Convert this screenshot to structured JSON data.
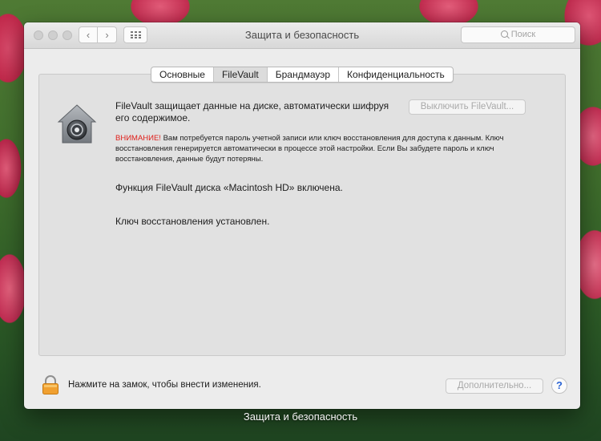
{
  "window": {
    "title": "Защита и безопасность",
    "search_placeholder": "Поиск",
    "nav_back": "‹",
    "nav_forward": "›"
  },
  "tabs": [
    {
      "label": "Основные",
      "active": false
    },
    {
      "label": "FileVault",
      "active": true
    },
    {
      "label": "Брандмауэр",
      "active": false
    },
    {
      "label": "Конфиденциальность",
      "active": false
    }
  ],
  "filevault": {
    "description": "FileVault защищает данные на диске, автоматически шифруя его содержимое.",
    "turn_off_button": "Выключить FileVault...",
    "warning_label": "ВНИМАНИЕ!",
    "warning_text": " Вам потребуется пароль учетной записи или ключ восстановления для доступа к данным. Ключ восстановления генерируется автоматически в процессе этой настройки. Если Вы забудете пароль и ключ восстановления, данные будут потеряны.",
    "status_enabled": "Функция FileVault диска «Macintosh HD» включена.",
    "status_key": "Ключ восстановления установлен."
  },
  "footer": {
    "lock_text": "Нажмите на замок, чтобы внести изменения.",
    "advanced_button": "Дополнительно...",
    "help_label": "?"
  },
  "caption": "Защита и безопасность",
  "colors": {
    "warning_red": "#e0201b",
    "lock_orange": "#f0a030",
    "help_blue": "#2a63d4"
  }
}
